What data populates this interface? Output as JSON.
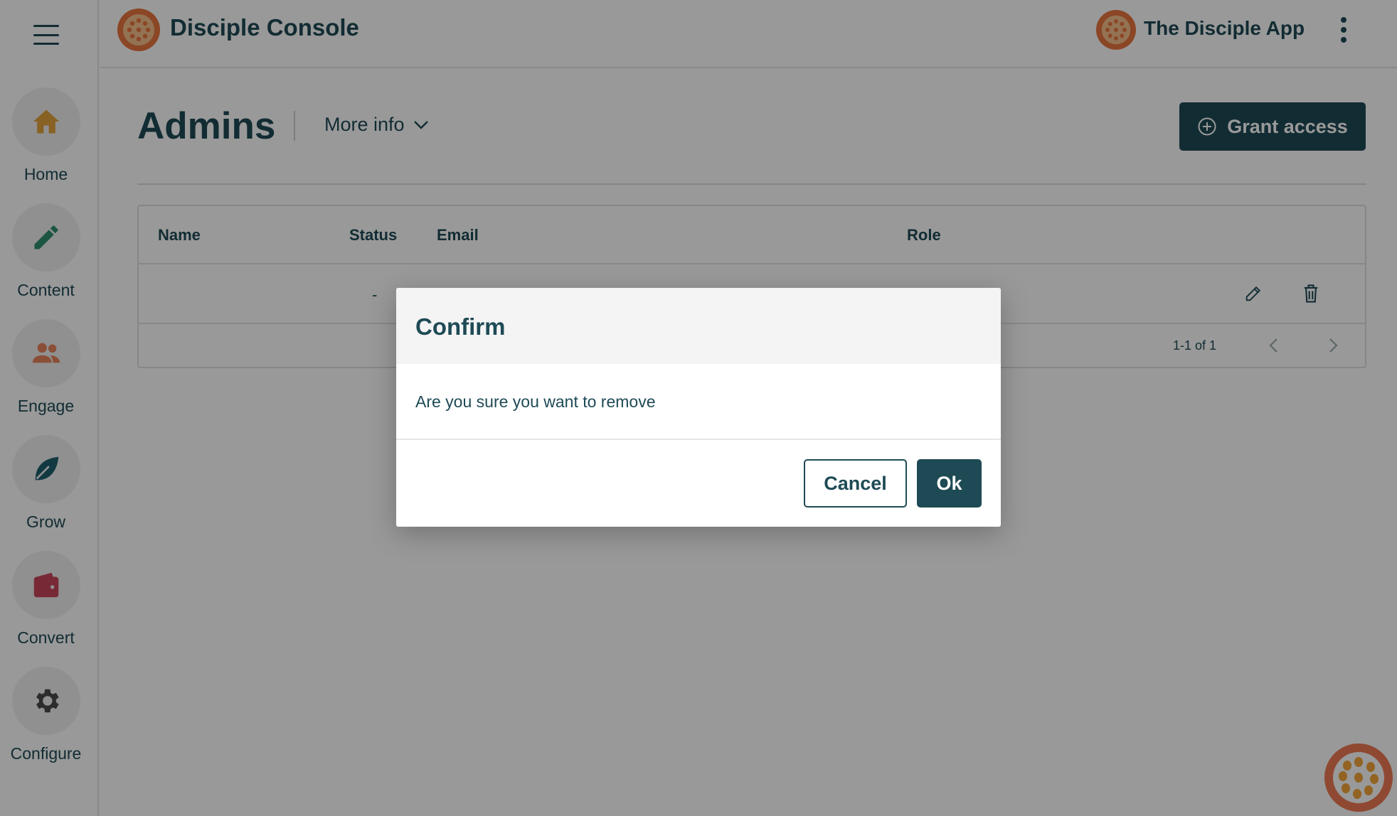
{
  "header": {
    "console_title": "Disciple Console",
    "app_name": "The Disciple App",
    "logo_icon": "passion-fruit-logo-icon",
    "menu_icon": "more-vertical-icon"
  },
  "sidebar": {
    "menu_icon": "hamburger-menu-icon",
    "items": [
      {
        "label": "Home",
        "icon": "home-icon",
        "color": "#e3a23d"
      },
      {
        "label": "Content",
        "icon": "pencil-icon",
        "color": "#2f8f6f"
      },
      {
        "label": "Engage",
        "icon": "people-icon",
        "color": "#e8835a"
      },
      {
        "label": "Grow",
        "icon": "leaf-icon",
        "color": "#1e5f6e"
      },
      {
        "label": "Convert",
        "icon": "wallet-icon",
        "color": "#c9455a"
      },
      {
        "label": "Configure",
        "icon": "gear-icon",
        "color": "#4a4a4a"
      }
    ]
  },
  "page": {
    "title": "Admins",
    "more_info": "More info",
    "grant_access": "Grant access"
  },
  "table": {
    "columns": [
      "Name",
      "Status",
      "Email",
      "Role"
    ],
    "rows": [
      {
        "name": "",
        "status": "-",
        "email": "",
        "role": ""
      }
    ],
    "pagination": "1-1 of 1"
  },
  "modal": {
    "title": "Confirm",
    "message": "Are you sure you want to remove",
    "cancel_label": "Cancel",
    "ok_label": "Ok"
  },
  "colors": {
    "primary": "#1e4a55",
    "brand_orange": "#e8763f",
    "overlay": "rgba(0,0,0,0.4)"
  }
}
